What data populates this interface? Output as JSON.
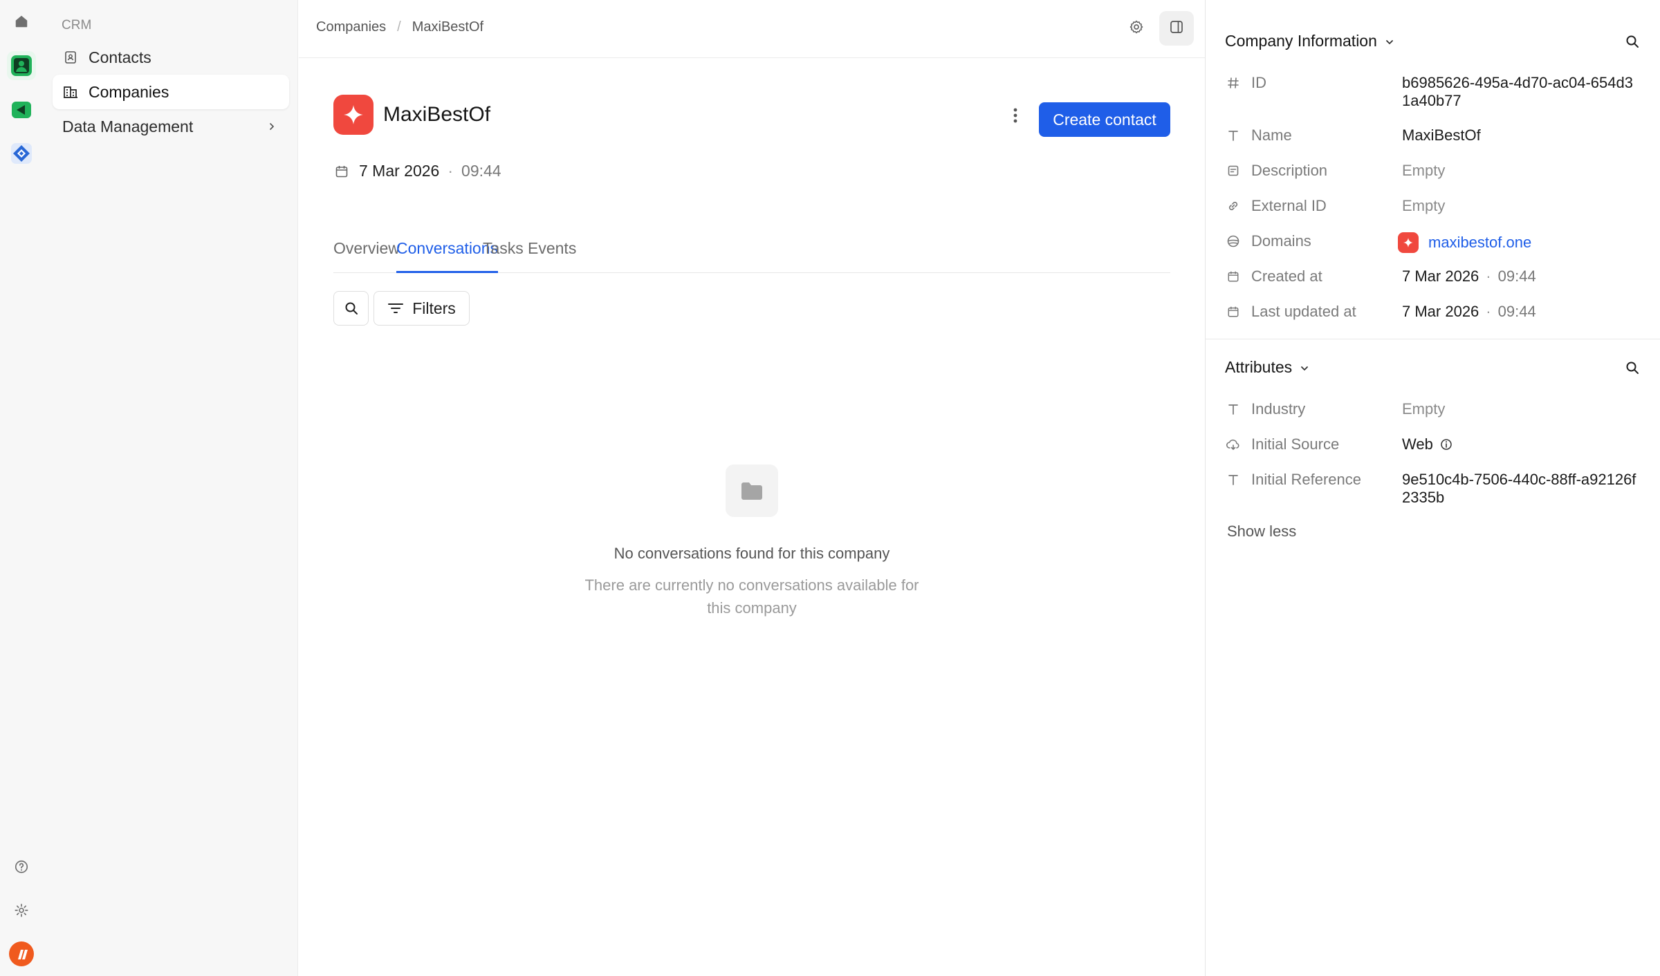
{
  "colors": {
    "accent": "#1f5ee8",
    "brand_logo": "#f0483e",
    "rail_app_green": "#20b25a",
    "rail_app_blue": "#2867d6",
    "rail_app_orange": "#f05a1e"
  },
  "rail": {
    "icons": [
      "home-icon",
      "crm-app-icon",
      "meet-app-icon",
      "logo-app-icon",
      "help-icon",
      "settings-icon",
      "account-app-icon"
    ]
  },
  "sidebar": {
    "section": "CRM",
    "items": [
      {
        "label": "Contacts",
        "icon": "contact-book-icon"
      },
      {
        "label": "Companies",
        "icon": "building-icon"
      },
      {
        "label": "Data Management",
        "icon": "chevron-right-icon"
      }
    ]
  },
  "breadcrumb": {
    "items": [
      "Companies",
      "MaxiBestOf"
    ],
    "separator": "/"
  },
  "company": {
    "name": "MaxiBestOf",
    "date": "7 Mar 2026",
    "dot": "·",
    "time": "09:44"
  },
  "actions": {
    "create_contact": "Create contact"
  },
  "tabs": [
    {
      "label": "Overview"
    },
    {
      "label": "Conversations"
    },
    {
      "label": "Tasks"
    },
    {
      "label": "Events"
    }
  ],
  "active_tab": "Conversations",
  "toolbar": {
    "filters": "Filters"
  },
  "empty_state": {
    "title": "No conversations found for this company",
    "subtitle": "There are currently no conversations available for this company"
  },
  "company_info": {
    "heading": "Company Information",
    "rows": [
      {
        "key": "ID",
        "value": "b6985626-495a-4d70-ac04-654d31a40b77",
        "icon": "hash-icon"
      },
      {
        "key": "Name",
        "value": "MaxiBestOf",
        "icon": "text-icon"
      },
      {
        "key": "Description",
        "value": "Empty",
        "icon": "note-icon"
      },
      {
        "key": "External ID",
        "value": "Empty",
        "icon": "link-icon"
      },
      {
        "key": "Domains",
        "value": "maxibestof.one",
        "icon": "globe-icon"
      },
      {
        "key": "Created at",
        "value": "7 Mar 2026",
        "time": "09:44",
        "icon": "calendar-icon"
      },
      {
        "key": "Last updated at",
        "value": "7 Mar 2026",
        "time": "09:44",
        "icon": "calendar-icon"
      }
    ]
  },
  "attributes": {
    "heading": "Attributes",
    "rows": [
      {
        "key": "Industry",
        "value": "Empty",
        "icon": "text-icon"
      },
      {
        "key": "Initial Source",
        "value": "Web",
        "icon": "cloud-icon"
      },
      {
        "key": "Initial Reference",
        "value": "9e510c4b-7506-440c-88ff-a92126f2335b",
        "icon": "text-icon"
      }
    ],
    "show_less": "Show less"
  }
}
